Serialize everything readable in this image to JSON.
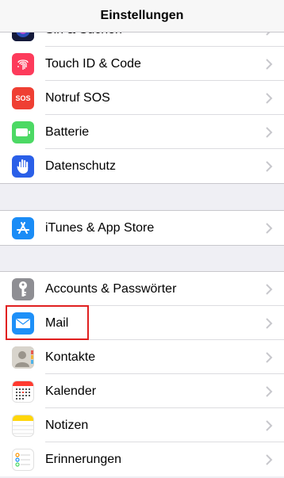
{
  "navbar": {
    "title": "Einstellungen"
  },
  "group1": [
    {
      "name": "siri",
      "label": "Siri & Suchen",
      "icon": "siri-icon",
      "color": "#1c2f6e"
    },
    {
      "name": "touchid",
      "label": "Touch ID & Code",
      "icon": "fingerprint-icon",
      "color": "#fd3b5b"
    },
    {
      "name": "sos",
      "label": "Notruf SOS",
      "icon": "sos-icon",
      "color": "#ef3f33",
      "icon_text": "SOS"
    },
    {
      "name": "battery",
      "label": "Batterie",
      "icon": "battery-icon",
      "color": "#4cd964"
    },
    {
      "name": "privacy",
      "label": "Datenschutz",
      "icon": "hand-icon",
      "color": "#2a5fe8"
    }
  ],
  "group2": [
    {
      "name": "appstore",
      "label": "iTunes & App Store",
      "icon": "app-store-icon",
      "color": "#1a8cf6"
    }
  ],
  "group3": [
    {
      "name": "accounts",
      "label": "Accounts & Passwörter",
      "icon": "key-icon",
      "color": "#8e8e93"
    },
    {
      "name": "mail",
      "label": "Mail",
      "icon": "mail-icon",
      "color": "#1e90f8"
    },
    {
      "name": "contacts",
      "label": "Kontakte",
      "icon": "contacts-icon",
      "color": "#c4c0b8"
    },
    {
      "name": "calendar",
      "label": "Kalender",
      "icon": "calendar-icon",
      "color": "#ffffff"
    },
    {
      "name": "notes",
      "label": "Notizen",
      "icon": "notes-icon",
      "color": "#ffffff"
    },
    {
      "name": "reminders",
      "label": "Erinnerungen",
      "icon": "reminders-icon",
      "color": "#ffffff"
    }
  ],
  "colors": {
    "highlight": "#e02020",
    "background": "#efeff4",
    "chevron": "#c7c7cc"
  }
}
